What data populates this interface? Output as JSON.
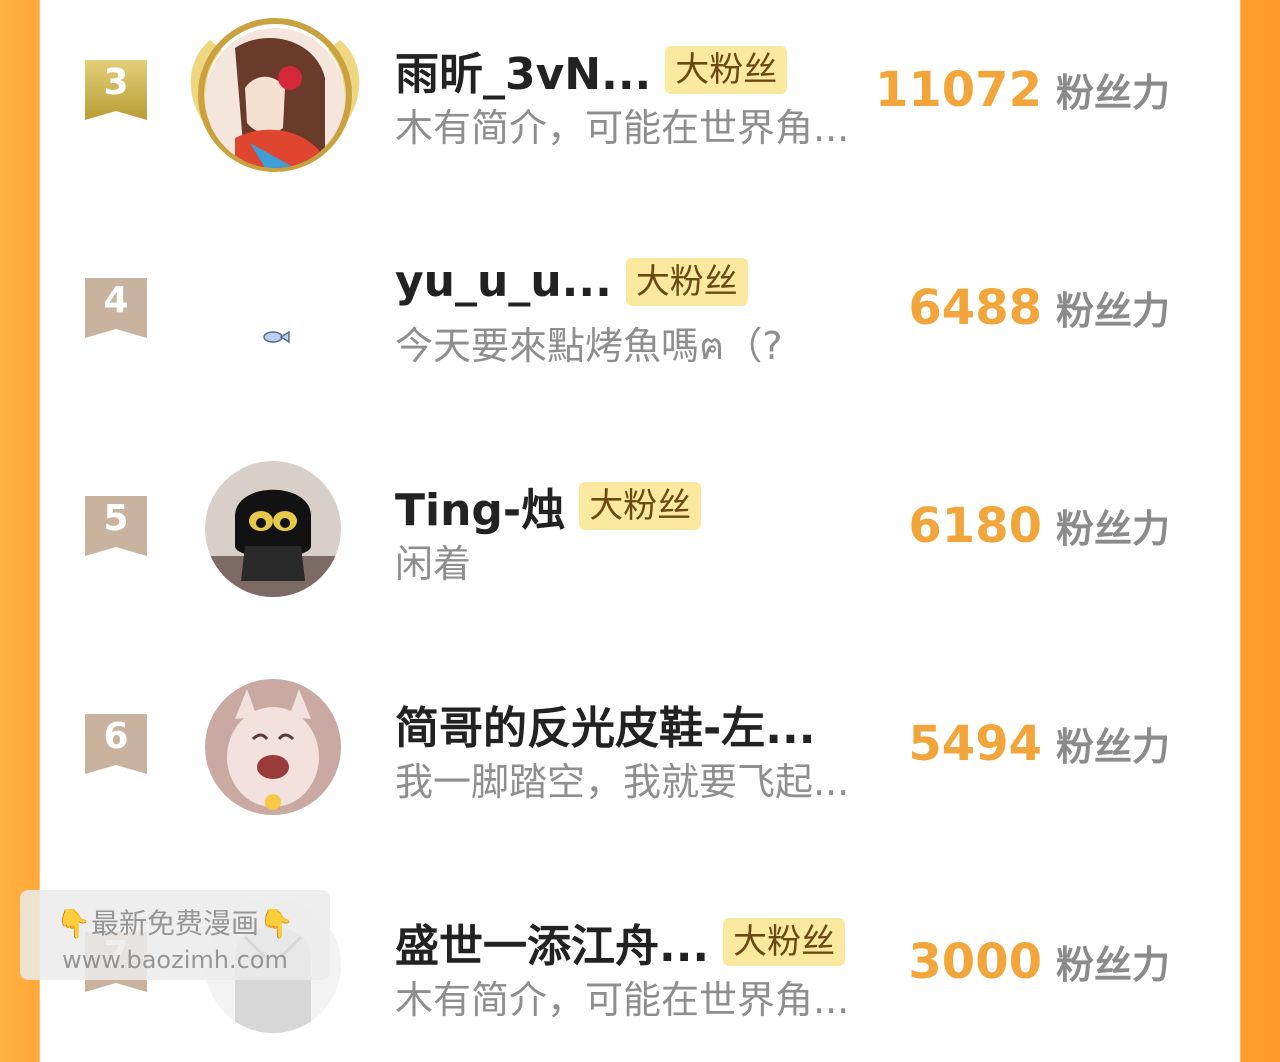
{
  "colors": {
    "accent": "#f2a53b",
    "badge_bg": "#fbe9a0",
    "side_orange": "#ffa93a"
  },
  "rows": [
    {
      "rank": "3",
      "name": "雨昕_3vN...",
      "badge": "大粉丝",
      "bio": "木有简介，可能在世界角...",
      "score": "11072",
      "unit": "粉丝力",
      "avatar": "anime-avatar-with-laurel-frame"
    },
    {
      "rank": "4",
      "name": "yu_u_u...",
      "badge": "大粉丝",
      "bio": "今天要來點烤魚嗎ฅ（?",
      "score": "6488",
      "unit": "粉丝力",
      "avatar": "fish-doodle"
    },
    {
      "rank": "5",
      "name": "Ting-烛",
      "badge": "大粉丝",
      "bio": "闲着",
      "score": "6180",
      "unit": "粉丝力",
      "avatar": "black-cat-avatar"
    },
    {
      "rank": "6",
      "name": "简哥的反光皮鞋-左...",
      "badge": "",
      "bio": "我一脚踏空，我就要飞起...",
      "score": "5494",
      "unit": "粉丝力",
      "avatar": "laughing-cat-avatar"
    },
    {
      "rank": "7",
      "name": "盛世一添江舟...",
      "badge": "大粉丝",
      "bio": "木有简介，可能在世界角...",
      "score": "3000",
      "unit": "粉丝力",
      "avatar": "manga-sketch-avatar"
    }
  ],
  "watermark": {
    "line1": "👇最新免费漫画👇",
    "line2": "www.baozimh.com"
  }
}
